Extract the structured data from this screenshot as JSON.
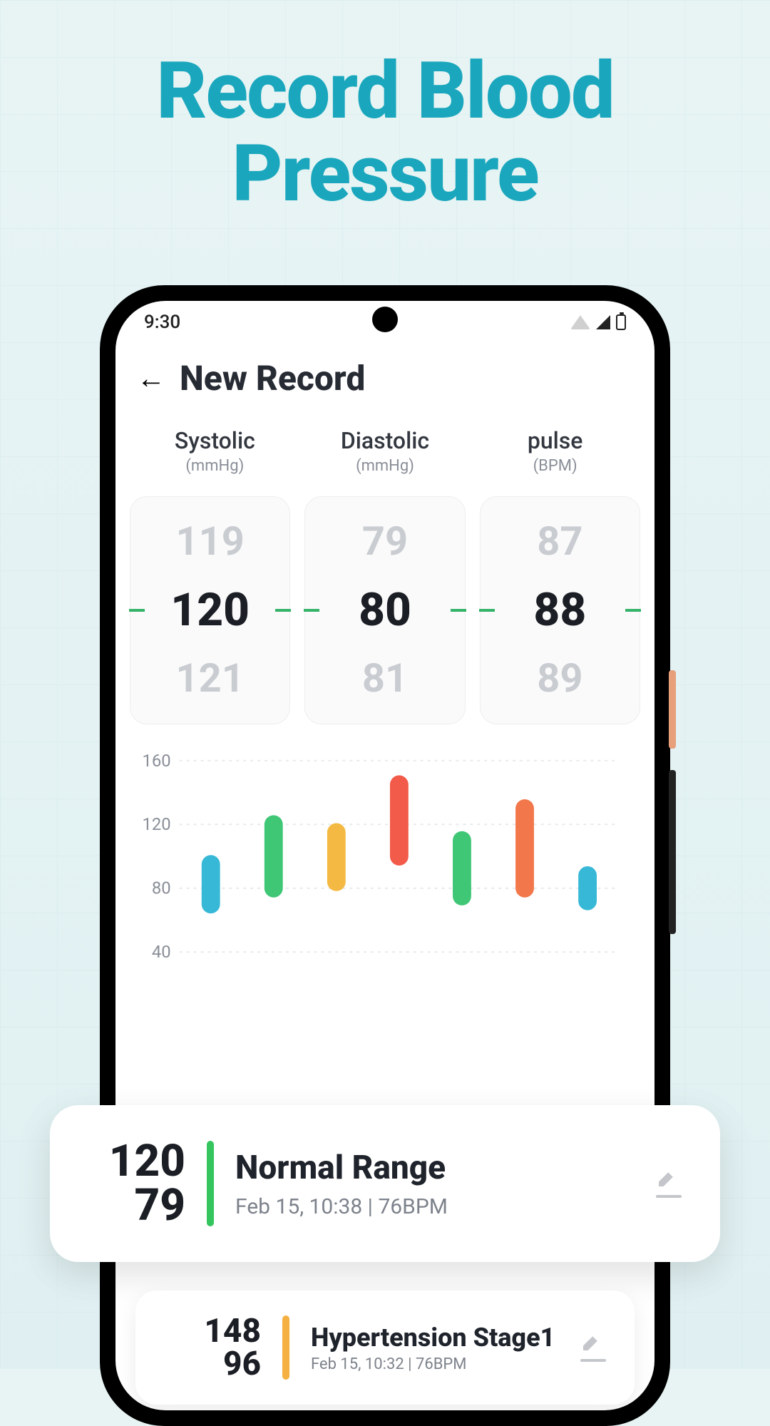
{
  "hero": {
    "line1": "Record Blood",
    "line2": "Pressure"
  },
  "status_bar": {
    "time": "9:30"
  },
  "header": {
    "title": "New Record"
  },
  "readings": {
    "systolic": {
      "label": "Systolic",
      "unit": "(mmHg)",
      "prev": "119",
      "value": "120",
      "next": "121"
    },
    "diastolic": {
      "label": "Diastolic",
      "unit": "(mmHg)",
      "prev": "79",
      "value": "80",
      "next": "81"
    },
    "pulse": {
      "label": "pulse",
      "unit": "(BPM)",
      "prev": "87",
      "value": "88",
      "next": "89"
    }
  },
  "chart_data": {
    "type": "bar",
    "ylabel": "",
    "xlabel": "",
    "ylim": [
      40,
      160
    ],
    "yticks": [
      160,
      120,
      80,
      40
    ],
    "series": [
      {
        "low": 70,
        "high": 95,
        "color": "#36b8d6"
      },
      {
        "low": 80,
        "high": 120,
        "color": "#3fc776"
      },
      {
        "low": 84,
        "high": 115,
        "color": "#f4b942"
      },
      {
        "low": 100,
        "high": 145,
        "color": "#f25b4a"
      },
      {
        "low": 75,
        "high": 110,
        "color": "#3fc776"
      },
      {
        "low": 80,
        "high": 130,
        "color": "#f2774a"
      },
      {
        "low": 72,
        "high": 88,
        "color": "#36b8d6"
      }
    ]
  },
  "cards": [
    {
      "sys": "120",
      "dia": "79",
      "status": "Normal Range",
      "meta": "Feb 15, 10:38 | 76BPM",
      "bar_color": "green"
    },
    {
      "sys": "148",
      "dia": "96",
      "status": "Hypertension Stage1",
      "meta": "Feb 15, 10:32 | 76BPM",
      "bar_color": "orange"
    }
  ]
}
